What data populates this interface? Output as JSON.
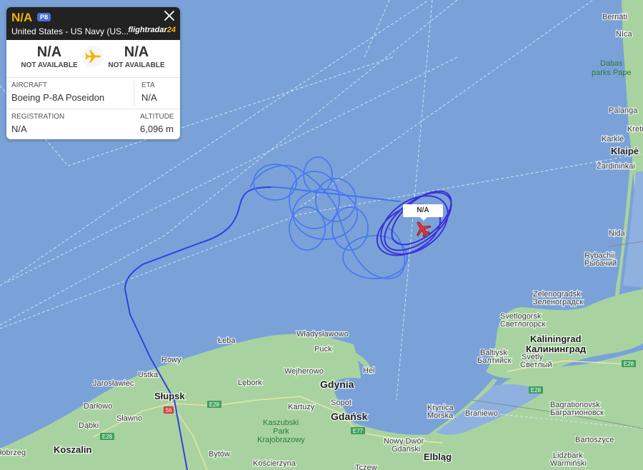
{
  "flight_card": {
    "callsign": "N/A",
    "type_badge": "P8",
    "operator": "United States - US Navy (US...",
    "brand_main": "flightradar",
    "brand_num": "24",
    "origin_code": "N/A",
    "origin_status": "NOT AVAILABLE",
    "destination_code": "N/A",
    "destination_status": "NOT AVAILABLE",
    "aircraft_label": "AIRCRAFT",
    "aircraft_value": "Boeing P-8A Poseidon",
    "eta_label": "ETA",
    "eta_value": "N/A",
    "registration_label": "REGISTRATION",
    "registration_value": "N/A",
    "altitude_label": "ALTITUDE",
    "altitude_value": "6,096 m"
  },
  "aircraft_tag": "N/A",
  "map_labels": {
    "bernati": "Bernāti",
    "nica": "Nīca",
    "dabas": "Dabas",
    "parks_pape": "parks Pape",
    "palanga": "Palanga",
    "kretinga": "Kretinga",
    "karkle": "Karklė",
    "klaipeda": "Klaipė",
    "zardininkai": "Žardininkai",
    "nida": "Nida",
    "rybachiy": "Rybachii",
    "rybachiy_ru": "Рыбачий",
    "zelenogradsk": "Zelenogradsk",
    "zelenogradsk_ru": "Зеленоградск",
    "svetlogorsk": "Svetlogorsk",
    "svetlogorsk_ru": "Светлогорск",
    "kaliningrad": "Kaliningrad",
    "kaliningrad_ru": "Калининград",
    "baltiysk": "Baltiysk",
    "baltiysk_ru": "Балтийск",
    "svetly": "Svetly",
    "svetly_ru": "Светлый",
    "bagrationovsk": "Bagrationovsk",
    "bagrationovsk_ru": "Багратионовск",
    "bartoszyce": "Bartoszyce",
    "lidzbark": "Lidzbark",
    "lidzbark2": "Warmiński",
    "braniewo": "Braniewo",
    "krynica": "Krynica",
    "morska": "Morska",
    "elblag": "Elbląg",
    "nowy_dwor": "Nowy Dwór",
    "gdanski": "Gdański",
    "gdansk": "Gdańsk",
    "gdynia": "Gdynia",
    "sopot": "Sopot",
    "hel": "Hel",
    "puck": "Puck",
    "wladyslawowo": "Władysławowo",
    "wejherowo": "Wejherowo",
    "leba": "Łeba",
    "lebork": "Lębork",
    "kartuzy": "Kartuzy",
    "kaszubski": "Kaszubski",
    "park": "Park",
    "krajobrazowy": "Krajobrazowy",
    "bytow": "Bytów",
    "koscierzyna": "Kościerzyna",
    "tczew": "Tczew",
    "rowy": "Rowy",
    "ustka": "Ustka",
    "jaroslawiec": "Jarosławiec",
    "slupsk": "Słupsk",
    "darlowo": "Darłowo",
    "slawno": "Sławno",
    "dabki": "Dąbki",
    "koszalin": "Koszalin",
    "kolobrzeg": "łobrzeg",
    "e28": "E28",
    "e77": "E77",
    "s6": "S6"
  },
  "colors": {
    "sea": "#7aa2d8",
    "land": "#a8d3a0",
    "track_light": "#3d6ef0",
    "track_dark": "#2c2ad6",
    "plane": "#e8322e"
  },
  "icons": [
    "close-icon",
    "airplane-icon",
    "aircraft-marker-icon"
  ]
}
